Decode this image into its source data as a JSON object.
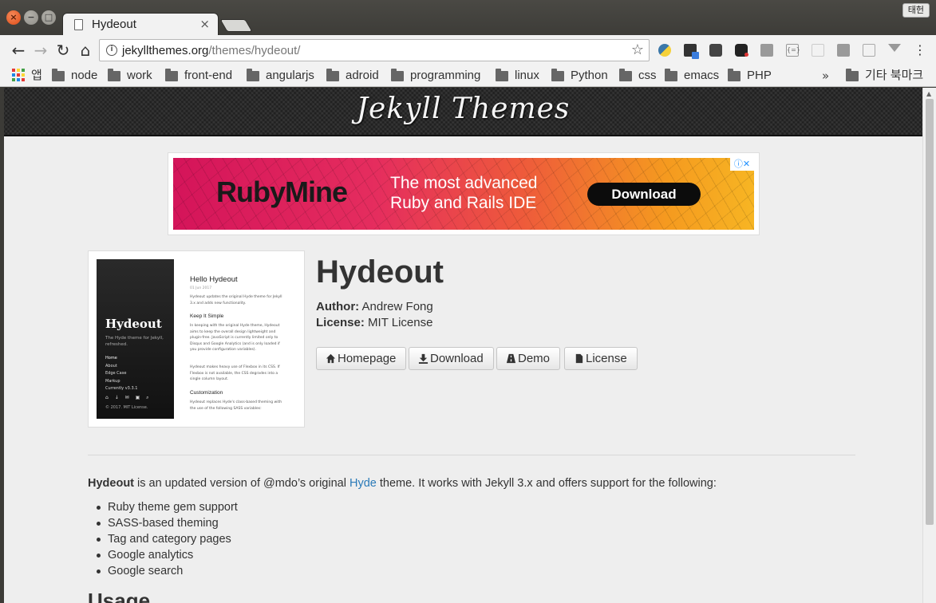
{
  "window": {
    "tab_title": "Hydeout",
    "tab_close": "×",
    "profile_label": "태헌"
  },
  "toolbar": {
    "url_host": "jekyllthemes.org",
    "url_path": "/themes/hydeout/",
    "back_icon": "←",
    "forward_icon": "→",
    "reload_icon": "↻",
    "home_icon": "⌂",
    "star_icon": "☆"
  },
  "bookmarks": {
    "apps_label": "앱",
    "items": [
      "node",
      "work",
      "front-end",
      "angularjs",
      "adroid",
      "programming",
      "linux",
      "Python",
      "css",
      "emacs",
      "PHP"
    ],
    "overflow_icon": "»",
    "other_label": "기타 북마크"
  },
  "site": {
    "title": "Jekyll Themes"
  },
  "ad": {
    "brand": "RubyMine",
    "tagline_1": "The most advanced",
    "tagline_2": "Ruby and Rails IDE",
    "cta": "Download",
    "choice": "ⓘ✕"
  },
  "thumbnail": {
    "side_title": "Hydeout",
    "side_sub": "The Hyde theme for Jekyll, refreshed.",
    "side_nav": [
      "Home",
      "About",
      "Edge Case",
      "Markup",
      "Currently v3.3.1"
    ],
    "side_icons": "⌂ ↓ ✉ ▣ ⌕",
    "side_foot": "© 2017. MIT License.",
    "post_title": "Hello Hydeout",
    "post_date": "01 Jun 2017",
    "post_intro": "Hydeout updates the original Hyde theme for Jekyll 3.x and adds new functionality.",
    "sec1_title": "Keep It Simple",
    "sec1_p1": "In keeping with the original Hyde theme, Hydeout aims to keep the overall design lightweight and plugin-free. JavaScript is currently limited only to Disqus and Google Analytics (and is only loaded if you provide configuration variables).",
    "sec1_p2": "Hydeout makes heavy use of Flexbox in its CSS. If Flexbox is not available, the CSS degrades into a single column layout.",
    "sec2_title": "Customization",
    "sec2_p1": "Hydeout replaces Hyde's class-based theming with the use of the following SASS variables:"
  },
  "theme": {
    "name": "Hydeout",
    "author_label": "Author:",
    "author": "Andrew Fong",
    "license_label": "License:",
    "license": "MIT License",
    "buttons": {
      "homepage": "Homepage",
      "download": "Download",
      "demo": "Demo",
      "license": "License"
    }
  },
  "description": {
    "name": "Hydeout",
    "text_1": " is an updated version of @mdo’s original ",
    "link": "Hyde",
    "text_2": " theme. It works with Jekyll 3.x and offers support for the following:"
  },
  "features": [
    "Ruby theme gem support",
    "SASS-based theming",
    "Tag and category pages",
    "Google analytics",
    "Google search"
  ],
  "usage_heading": "Usage",
  "colors": {
    "link": "#2a7ab8",
    "ad_gradient_start": "#d4145a",
    "ad_gradient_end": "#f7b523"
  }
}
